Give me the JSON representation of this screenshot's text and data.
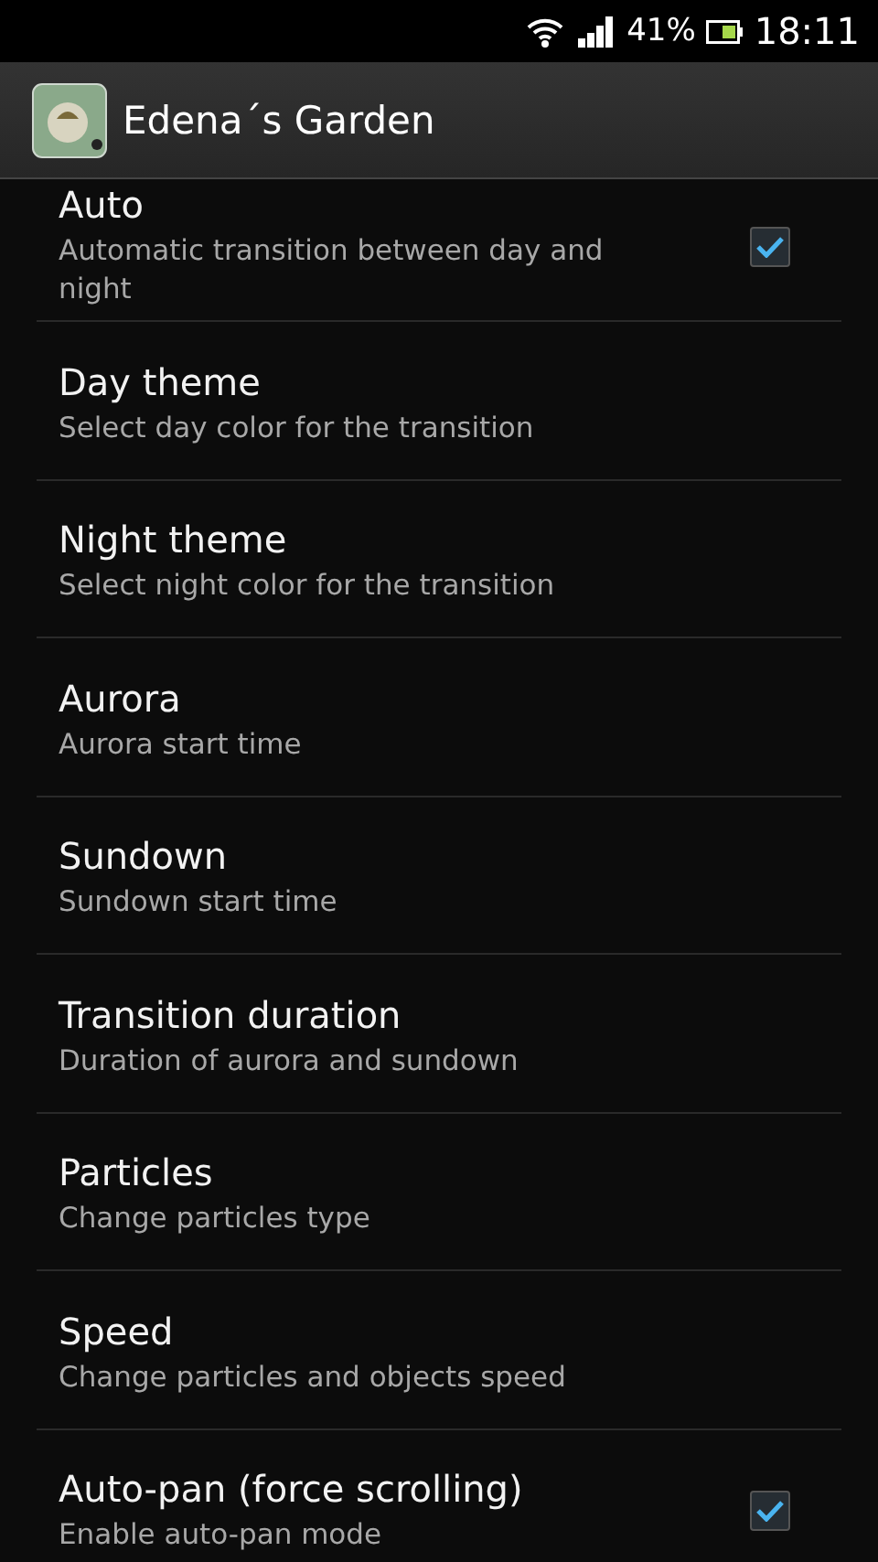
{
  "status_bar": {
    "battery": "41%",
    "time": "18:11"
  },
  "app_bar": {
    "title": "Edena´s Garden"
  },
  "settings": [
    {
      "kind": "checkbox",
      "title": "Auto",
      "summary": "Automatic transition between day and night",
      "checked": true
    },
    {
      "kind": "plain",
      "title": "Day theme",
      "summary": "Select day color for the transition"
    },
    {
      "kind": "plain",
      "title": "Night theme",
      "summary": "Select night color for the transition"
    },
    {
      "kind": "plain",
      "title": "Aurora",
      "summary": "Aurora start time"
    },
    {
      "kind": "plain",
      "title": "Sundown",
      "summary": "Sundown start time"
    },
    {
      "kind": "plain",
      "title": "Transition duration",
      "summary": "Duration of aurora and sundown"
    },
    {
      "kind": "plain",
      "title": "Particles",
      "summary": "Change particles type"
    },
    {
      "kind": "plain",
      "title": "Speed",
      "summary": "Change particles and objects speed"
    },
    {
      "kind": "checkbox",
      "title": "Auto-pan (force scrolling)",
      "summary": "Enable auto-pan mode",
      "checked": true
    }
  ]
}
